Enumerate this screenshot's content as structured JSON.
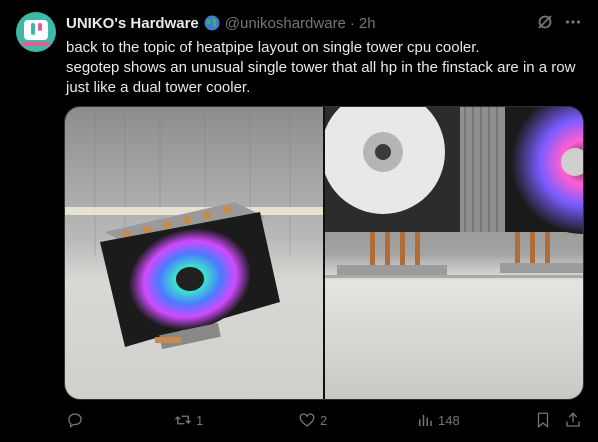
{
  "author": {
    "display_name": "UNIKO's Hardware",
    "handle": "@unikoshardware",
    "separator": "·",
    "time": "2h",
    "avatar_icon": "uniko-logo",
    "badge_icon": "globe-icon"
  },
  "tweet": {
    "lines": [
      "back to the topic of heatpipe layout on single tower cpu cooler.",
      "segotep shows an unusual single tower that all hp in the finstack are in a row",
      "just like a dual tower cooler."
    ]
  },
  "media": {
    "count": 2,
    "images": [
      "cooler-photo-rgb-fan",
      "cooler-photo-heatpipes-closeup"
    ]
  },
  "actions": {
    "reply_count": "",
    "retweet_count": "1",
    "like_count": "2",
    "view_count": "148"
  },
  "colors": {
    "background": "#000000",
    "text_primary": "#e7e9ea",
    "text_secondary": "#71767b",
    "border": "#2f3336"
  }
}
